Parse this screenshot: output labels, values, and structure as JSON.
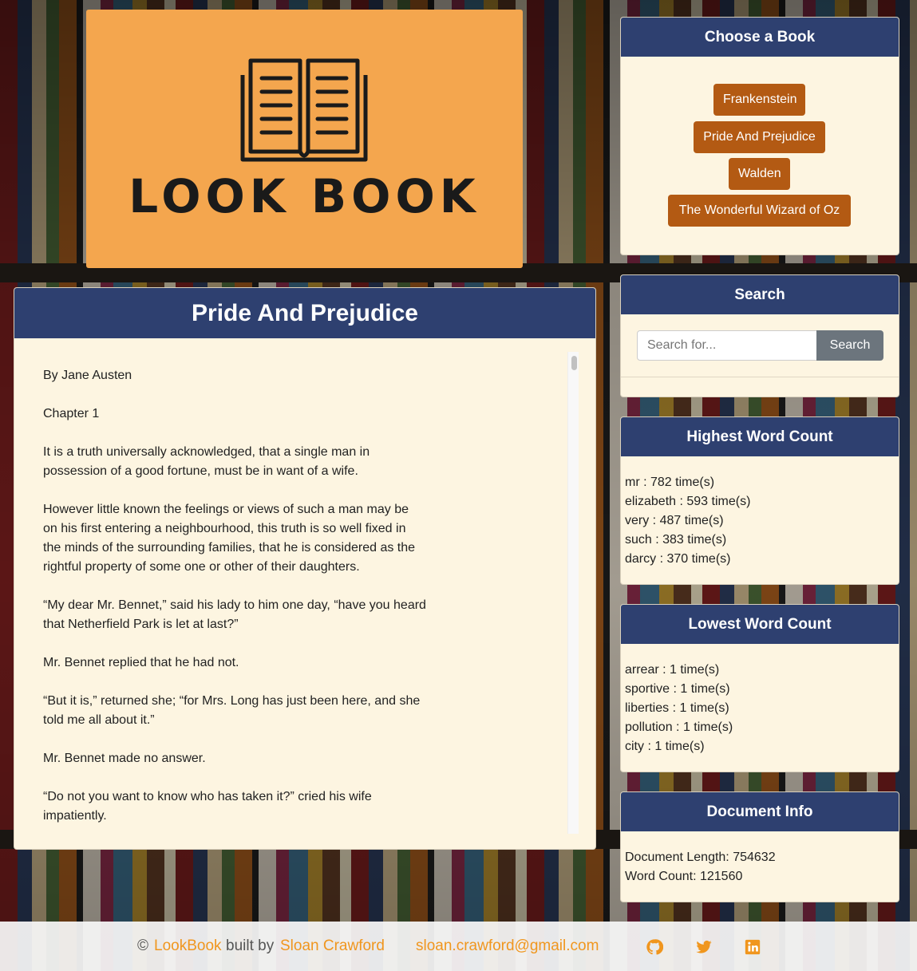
{
  "logo": {
    "text": "LOOK BOOK",
    "bg_color": "#f4a64e"
  },
  "reader": {
    "title": "Pride And Prejudice",
    "paragraphs": [
      "By Jane Austen",
      "Chapter 1",
      "It is a truth universally acknowledged, that a single man in possession of a good fortune, must be in want of a wife.",
      "However little known the feelings or views of such a man may be on his first entering a neighbourhood, this truth is so well fixed in the minds of the surrounding families, that he is considered as the rightful property of some one or other of their daughters.",
      "“My dear Mr. Bennet,” said his lady to him one day, “have you heard that Netherfield Park is let at last?”",
      "Mr. Bennet replied that he had not.",
      "“But it is,” returned she; “for Mrs. Long has just been here, and she told me all about it.”",
      "Mr. Bennet made no answer.",
      "“Do not you want to know who has taken it?” cried his wife impatiently."
    ]
  },
  "choose": {
    "title": "Choose a Book",
    "books": [
      "Frankenstein",
      "Pride And Prejudice",
      "Walden",
      "The Wonderful Wizard of Oz"
    ]
  },
  "search": {
    "title": "Search",
    "placeholder": "Search for...",
    "button": "Search"
  },
  "highest": {
    "title": "Highest Word Count",
    "items": [
      "mr : 782 time(s)",
      "elizabeth : 593 time(s)",
      "very : 487 time(s)",
      "such : 383 time(s)",
      "darcy : 370 time(s)"
    ]
  },
  "lowest": {
    "title": "Lowest Word Count",
    "items": [
      "arrear : 1 time(s)",
      "sportive : 1 time(s)",
      "liberties : 1 time(s)",
      "pollution : 1 time(s)",
      "city : 1 time(s)"
    ]
  },
  "docinfo": {
    "title": "Document Info",
    "length": "Document Length: 754632",
    "words": "Word Count: 121560"
  },
  "footer": {
    "copyright": "©",
    "brand": "LookBook",
    "built_by": "built by",
    "author": "Sloan Crawford",
    "email": "sloan.crawford@gmail.com",
    "icons": [
      "github-icon",
      "twitter-icon",
      "linkedin-icon"
    ],
    "accent": "#f0961e"
  },
  "colors": {
    "header": "#2e4070",
    "card_bg": "#fdf5e1",
    "book_button": "#b35a13"
  }
}
